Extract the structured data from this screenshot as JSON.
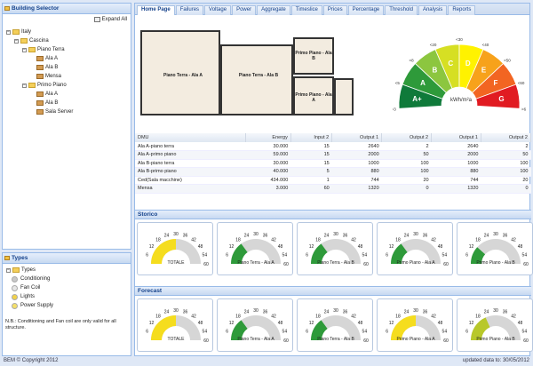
{
  "building_selector": {
    "title": "Building Selector",
    "expand_all": "Expand All",
    "tree": [
      {
        "label": "Italy",
        "level": 0,
        "type": "folder"
      },
      {
        "label": "Cascina",
        "level": 1,
        "type": "folder"
      },
      {
        "label": "Piano Terra",
        "level": 2,
        "type": "folder"
      },
      {
        "label": "Ala A",
        "level": 3,
        "type": "leaf"
      },
      {
        "label": "Ala B",
        "level": 3,
        "type": "leaf"
      },
      {
        "label": "Mensa",
        "level": 3,
        "type": "leaf"
      },
      {
        "label": "Primo Piano",
        "level": 2,
        "type": "folder"
      },
      {
        "label": "Ala A",
        "level": 3,
        "type": "leaf"
      },
      {
        "label": "Ala B",
        "level": 3,
        "type": "leaf"
      },
      {
        "label": "Sala Server",
        "level": 3,
        "type": "leaf"
      }
    ]
  },
  "types": {
    "title": "Types",
    "root": "Types",
    "items": [
      {
        "label": "Conditioning",
        "color": "#c8c8c8"
      },
      {
        "label": "Fan Coil",
        "color": "#e6e6e6"
      },
      {
        "label": "Lights",
        "color": "#f2d24a"
      },
      {
        "label": "Power Supply",
        "color": "#f5e06a"
      }
    ],
    "note": "N.B.: Conditioning and Fan coil are only valid for all structure."
  },
  "tabs": [
    "Home Page",
    "Failures",
    "Voltage",
    "Power",
    "Aggregate",
    "Timeslice",
    "Prices",
    "Percentage",
    "Threshold",
    "Analysis",
    "Reports"
  ],
  "floorplan": {
    "labels": [
      "Piano Terra - Ala A",
      "Piano Terra - Ala B",
      "Primo Piano - Ala B",
      "Primo Piano - Ala A"
    ]
  },
  "energy_rating": {
    "unit": "kWh/m²a",
    "classes": [
      {
        "label": "A+",
        "color": "#0f7a3a"
      },
      {
        "label": "A",
        "color": "#2e9a3a"
      },
      {
        "label": "B",
        "color": "#8cc63f"
      },
      {
        "label": "C",
        "color": "#d6df23"
      },
      {
        "label": "D",
        "color": "#fff200"
      },
      {
        "label": "E",
        "color": "#f7a21b"
      },
      {
        "label": "F",
        "color": "#f26522"
      },
      {
        "label": "G",
        "color": "#e11b22"
      }
    ],
    "thresholds": [
      "<3",
      "<5",
      "<8",
      "<20",
      "<30",
      "<40",
      "<50",
      "<60",
      ">60"
    ]
  },
  "table": {
    "columns": [
      "DMU",
      "Energy",
      "Input 2",
      "Output 1",
      "Output 2",
      "Output 1",
      "Output 2"
    ],
    "rows": [
      [
        "Ala A-piano terra",
        "30.000",
        "15",
        "2640",
        "2",
        "2640",
        "2"
      ],
      [
        "Ala A-primo piano",
        "59.000",
        "15",
        "2000",
        "50",
        "2000",
        "50"
      ],
      [
        "Ala B-piano terra",
        "30.000",
        "15",
        "1000",
        "100",
        "1000",
        "100"
      ],
      [
        "Ala B-primo piano",
        "40.000",
        "5",
        "880",
        "100",
        "880",
        "100"
      ],
      [
        "Ced(Sala macchine)",
        "434.000",
        "1",
        "744",
        "20",
        "744",
        "20"
      ],
      [
        "Mensa",
        "3.000",
        "60",
        "1320",
        "0",
        "1320",
        "0"
      ]
    ]
  },
  "storico": {
    "title": "Storico",
    "gauges": [
      {
        "label": "TOTALE",
        "value": 30,
        "color": "#f5dd1e"
      },
      {
        "label": "Piano Terra - Ala A",
        "value": 18,
        "color": "#2e9a3a"
      },
      {
        "label": "Piano Terra - Ala B",
        "value": 18,
        "color": "#2e9a3a"
      },
      {
        "label": "Primo Piano - Ala A",
        "value": 18,
        "color": "#2e9a3a"
      },
      {
        "label": "Primo Piano - Ala B",
        "value": 14,
        "color": "#2e9a3a"
      }
    ]
  },
  "forecast": {
    "title": "Forecast",
    "gauges": [
      {
        "label": "TOTALE",
        "value": 30,
        "color": "#f5dd1e"
      },
      {
        "label": "Piano Terra - Ala A",
        "value": 18,
        "color": "#2e9a3a"
      },
      {
        "label": "Piano Terra - Ala B",
        "value": 18,
        "color": "#2e9a3a"
      },
      {
        "label": "Primo Piano - Ala A",
        "value": 30,
        "color": "#f5dd1e"
      },
      {
        "label": "Primo Piano - Ala B",
        "value": 22,
        "color": "#b8c82a"
      }
    ]
  },
  "gauge_ticks": [
    "6",
    "12",
    "18",
    "24",
    "30",
    "36",
    "42",
    "48",
    "54",
    "60"
  ],
  "footer": {
    "copyright": "BEM © Copyright 2012",
    "updated": "updated data to: 30/05/2012"
  }
}
